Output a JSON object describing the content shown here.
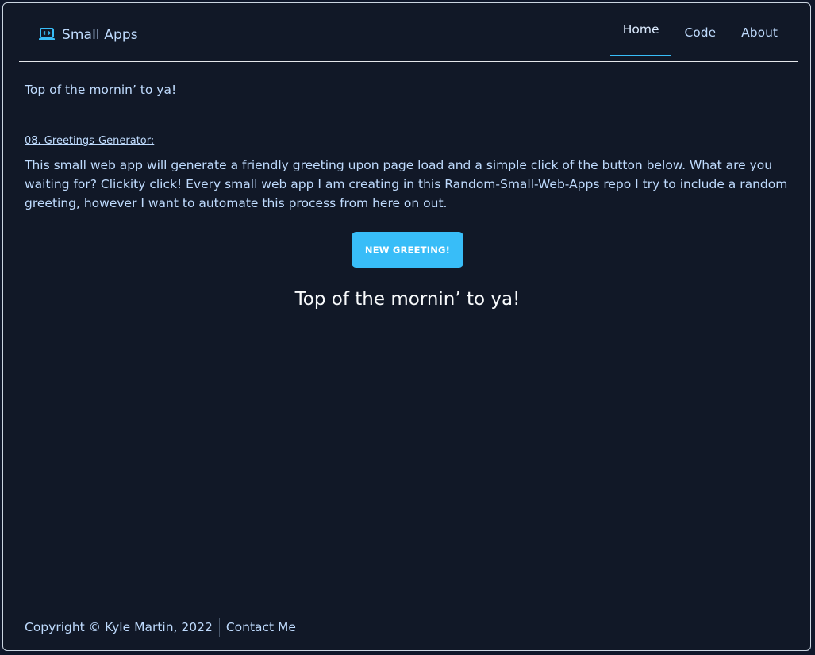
{
  "header": {
    "brand": "Small Apps",
    "brand_icon": "laptop-code-icon",
    "nav": [
      {
        "label": "Home",
        "active": true
      },
      {
        "label": "Code",
        "active": false
      },
      {
        "label": "About",
        "active": false
      }
    ]
  },
  "main": {
    "intro": "Top of the mornin’ to ya!",
    "app_link": "08. Greetings-Generator:",
    "description": "This small web app will generate a friendly greeting upon page load and a simple click of the button below. What are you waiting for? Clickity click! Every small web app I am creating in this Random-Small-Web-Apps repo I try to include a random greeting, however I want to automate this process from here on out.",
    "button_label": "NEW GREETING!",
    "greeting": "Top of the mornin’ to ya!"
  },
  "footer": {
    "copyright": "Copyright © Kyle Martin, 2022",
    "contact": "Contact Me"
  },
  "colors": {
    "background": "#111827",
    "accent": "#38bdf8",
    "text": "#bfdbfe"
  }
}
